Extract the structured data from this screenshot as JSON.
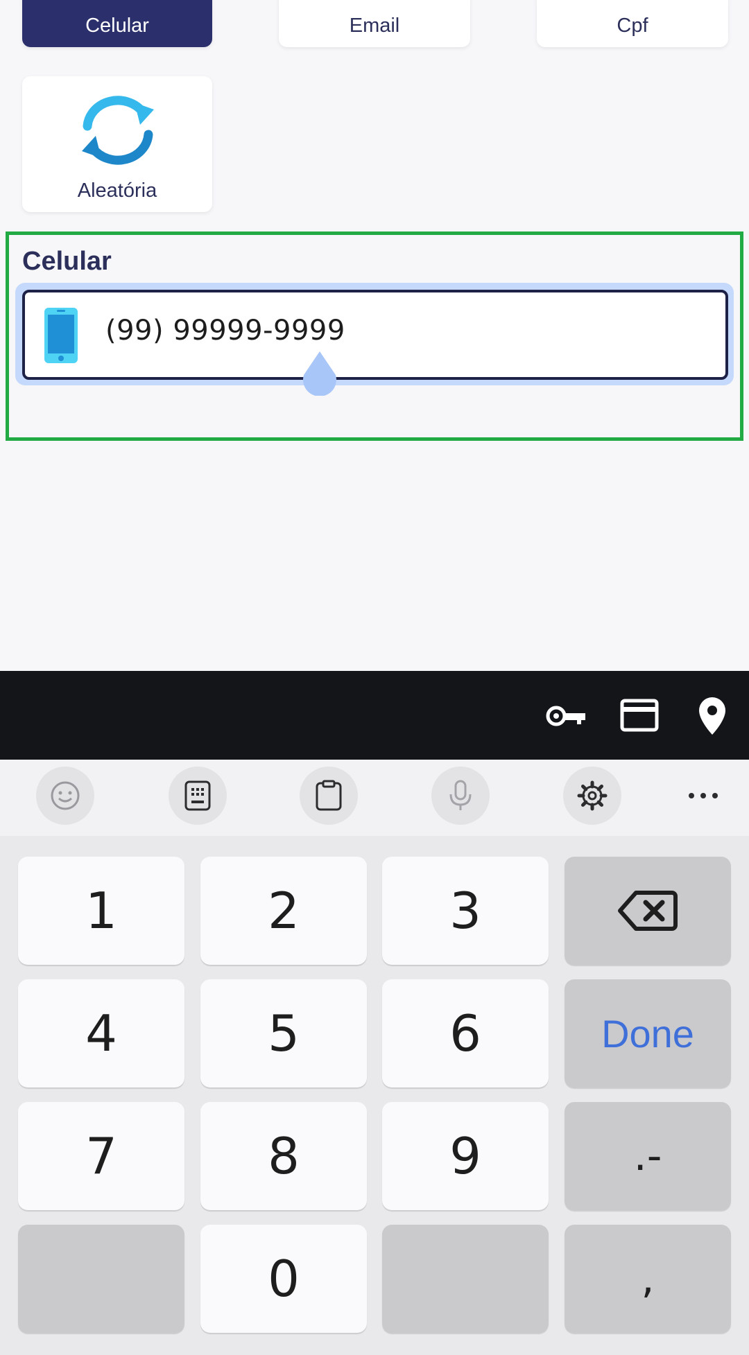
{
  "key_types": [
    {
      "label": "Celular",
      "selected": true
    },
    {
      "label": "Email",
      "selected": false
    },
    {
      "label": "Cpf",
      "selected": false
    },
    {
      "label": "Aleatória",
      "selected": false,
      "icon": "refresh-icon"
    }
  ],
  "form": {
    "field_label": "Celular",
    "phone_value": "(99) 99999-9999",
    "icon": "smartphone-icon"
  },
  "autofill": {
    "icons": [
      "key-icon",
      "credit-card-icon",
      "location-pin-icon"
    ]
  },
  "keyboard_toolbar": {
    "icons": [
      "emoji-icon",
      "keypad-icon",
      "clipboard-icon",
      "microphone-icon",
      "settings-icon",
      "more-icon"
    ]
  },
  "keypad": {
    "keys": [
      "1",
      "2",
      "3",
      "4",
      "5",
      "6",
      "7",
      "8",
      "9",
      "0"
    ],
    "done_label": "Done",
    "dot_dash_label": ".-",
    "comma_label": ","
  },
  "colors": {
    "selected_card": "#2b2f6b",
    "frame_highlight": "#22aa44",
    "input_focus_halo": "#c4d9fb",
    "done_text": "#3f6fd8"
  }
}
